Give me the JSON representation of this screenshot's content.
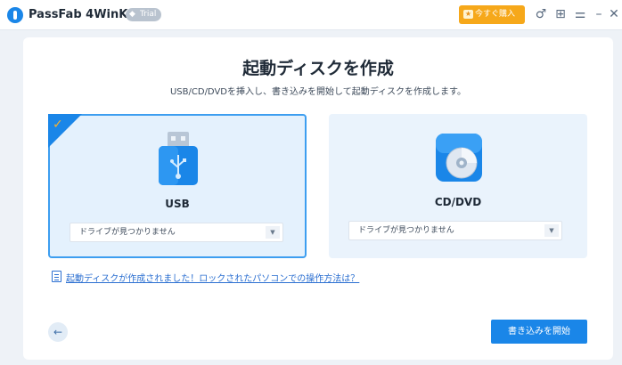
{
  "app": {
    "title": "PassFab 4WinKey",
    "badge": "Trial",
    "buy_label": "今すぐ購入",
    "icons": [
      "gender-male-icon",
      "list-icon",
      "settings-icon",
      "minimize-icon",
      "close-icon"
    ],
    "icon_glyphs": [
      "♂",
      "⊞",
      "⚌",
      "–",
      "✕"
    ]
  },
  "page": {
    "title": "起動ディスクを作成",
    "subtitle": "USB/CD/DVDを挿入し、書き込みを開始して起動ディスクを作成します。"
  },
  "options": [
    {
      "label": "USB",
      "selected": true,
      "select_value": "ドライブが見つかりません"
    },
    {
      "label": "CD/DVD",
      "selected": false,
      "select_value": "ドライブが見つかりません"
    }
  ],
  "help_link": "起動ディスクが作成されました！ロックされたパソコンでの操作方法は？",
  "actions": {
    "back_glyph": "←",
    "burn_label": "書き込みを開始"
  },
  "colors": {
    "accent": "#1a86e8",
    "buy": "#f6a81a",
    "link": "#2b6fd1"
  }
}
